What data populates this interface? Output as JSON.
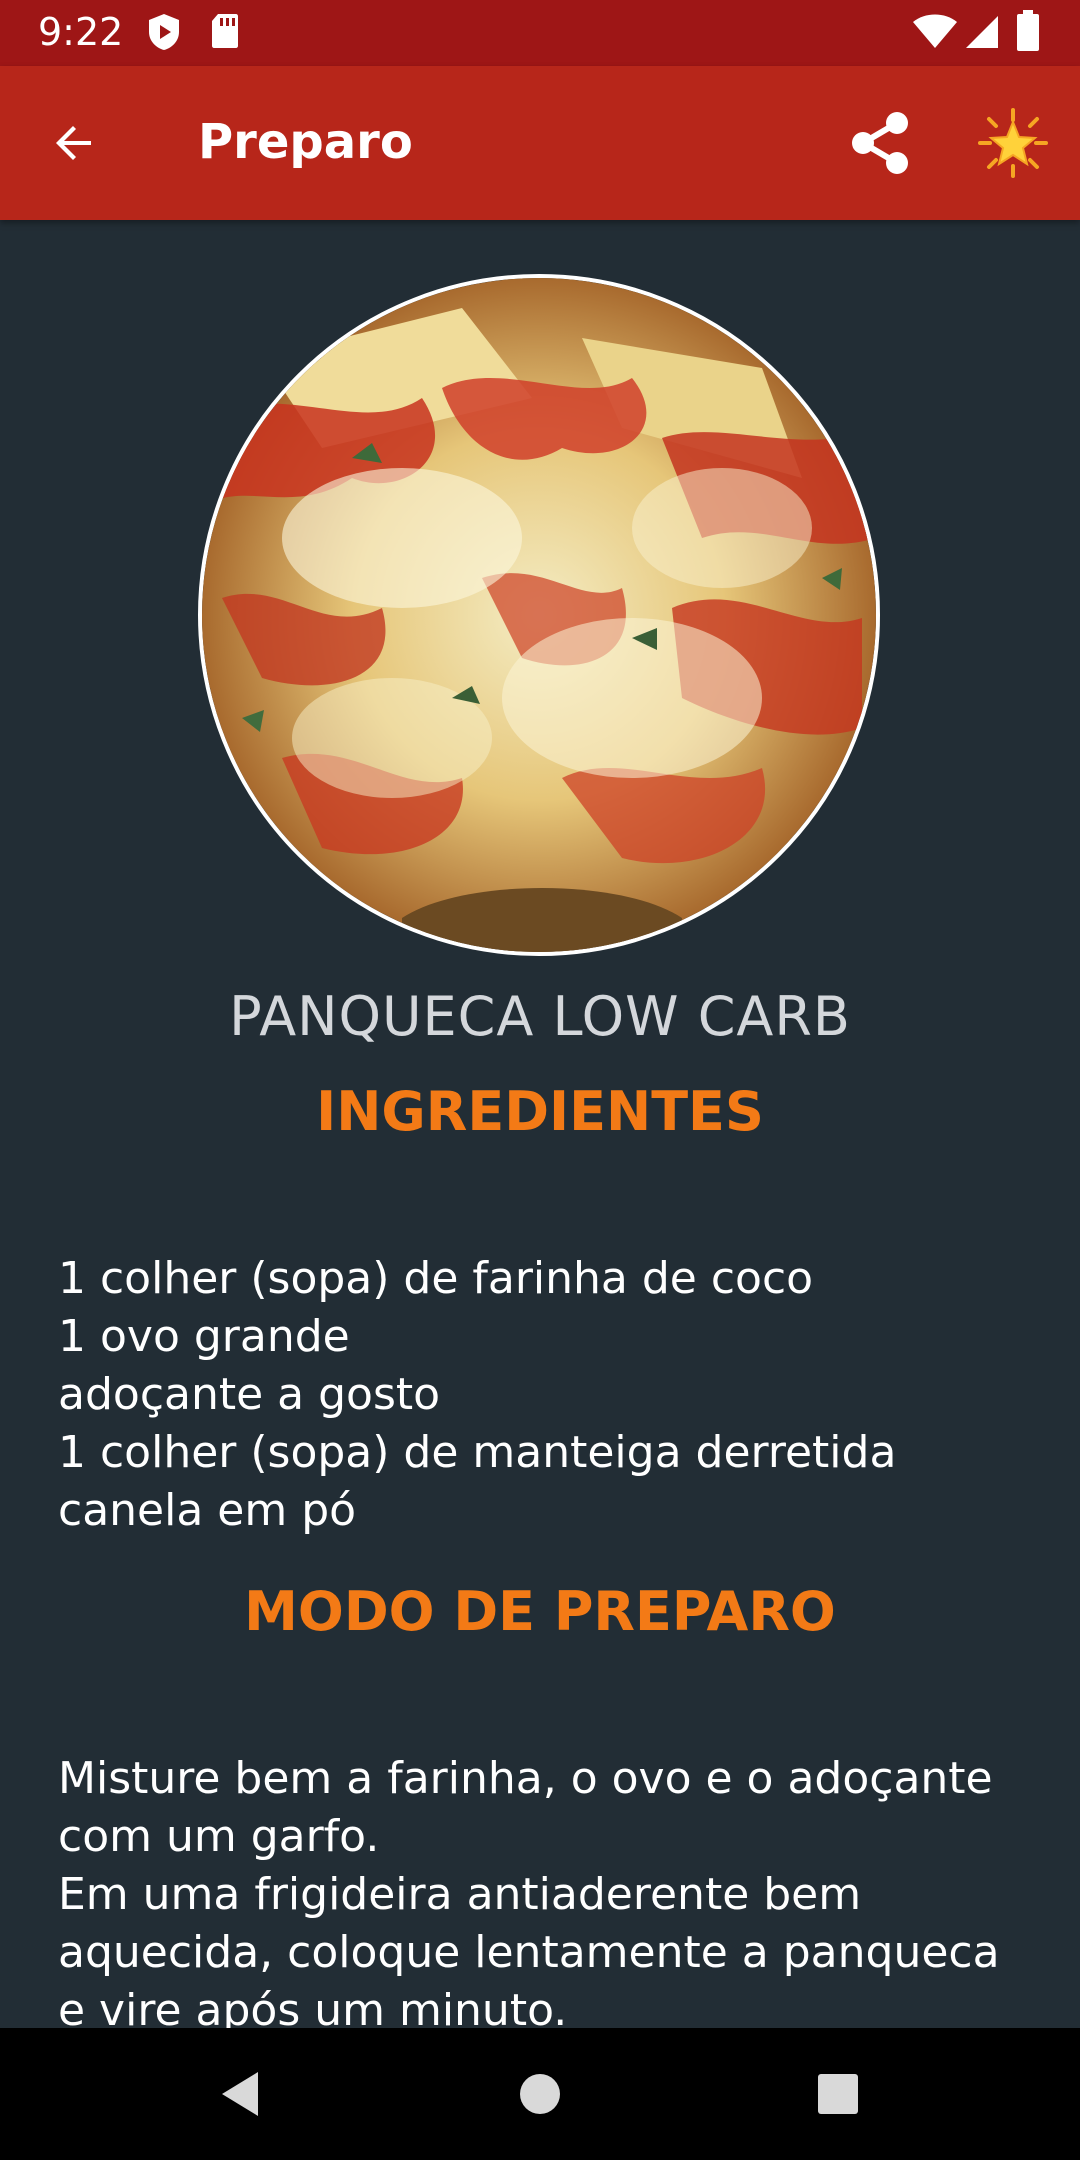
{
  "status_bar": {
    "time": "9:22",
    "icons": [
      "play-protect-icon",
      "sd-card-icon",
      "wifi-icon",
      "signal-icon",
      "battery-icon"
    ]
  },
  "app_bar": {
    "title": "Preparo",
    "back_icon": "arrow-back-icon",
    "share_icon": "share-icon",
    "favorite_icon": "star-burst-icon"
  },
  "recipe": {
    "title": "PANQUECA LOW CARB",
    "ingredients_heading": "INGREDIENTES",
    "ingredients": [
      "1 colher (sopa) de farinha de coco",
      "1 ovo grande",
      "adoçante a gosto",
      "1 colher (sopa) de manteiga derretida",
      "canela em pó"
    ],
    "preparation_heading": "MODO DE PREPARO",
    "preparation_lines": [
      "Misture bem a farinha, o ovo e o adoçante",
      "com um garfo.",
      "Em uma frigideira antiaderente bem",
      "aquecida, coloque lentamente a panqueca",
      "e vire após um minuto."
    ]
  },
  "colors": {
    "status_bar": "#9e1616",
    "app_bar": "#b7261a",
    "background": "#222d35",
    "heading": "#f37a16"
  },
  "nav_bar": {
    "icons": [
      "back-triangle-icon",
      "home-circle-icon",
      "recents-square-icon"
    ]
  }
}
